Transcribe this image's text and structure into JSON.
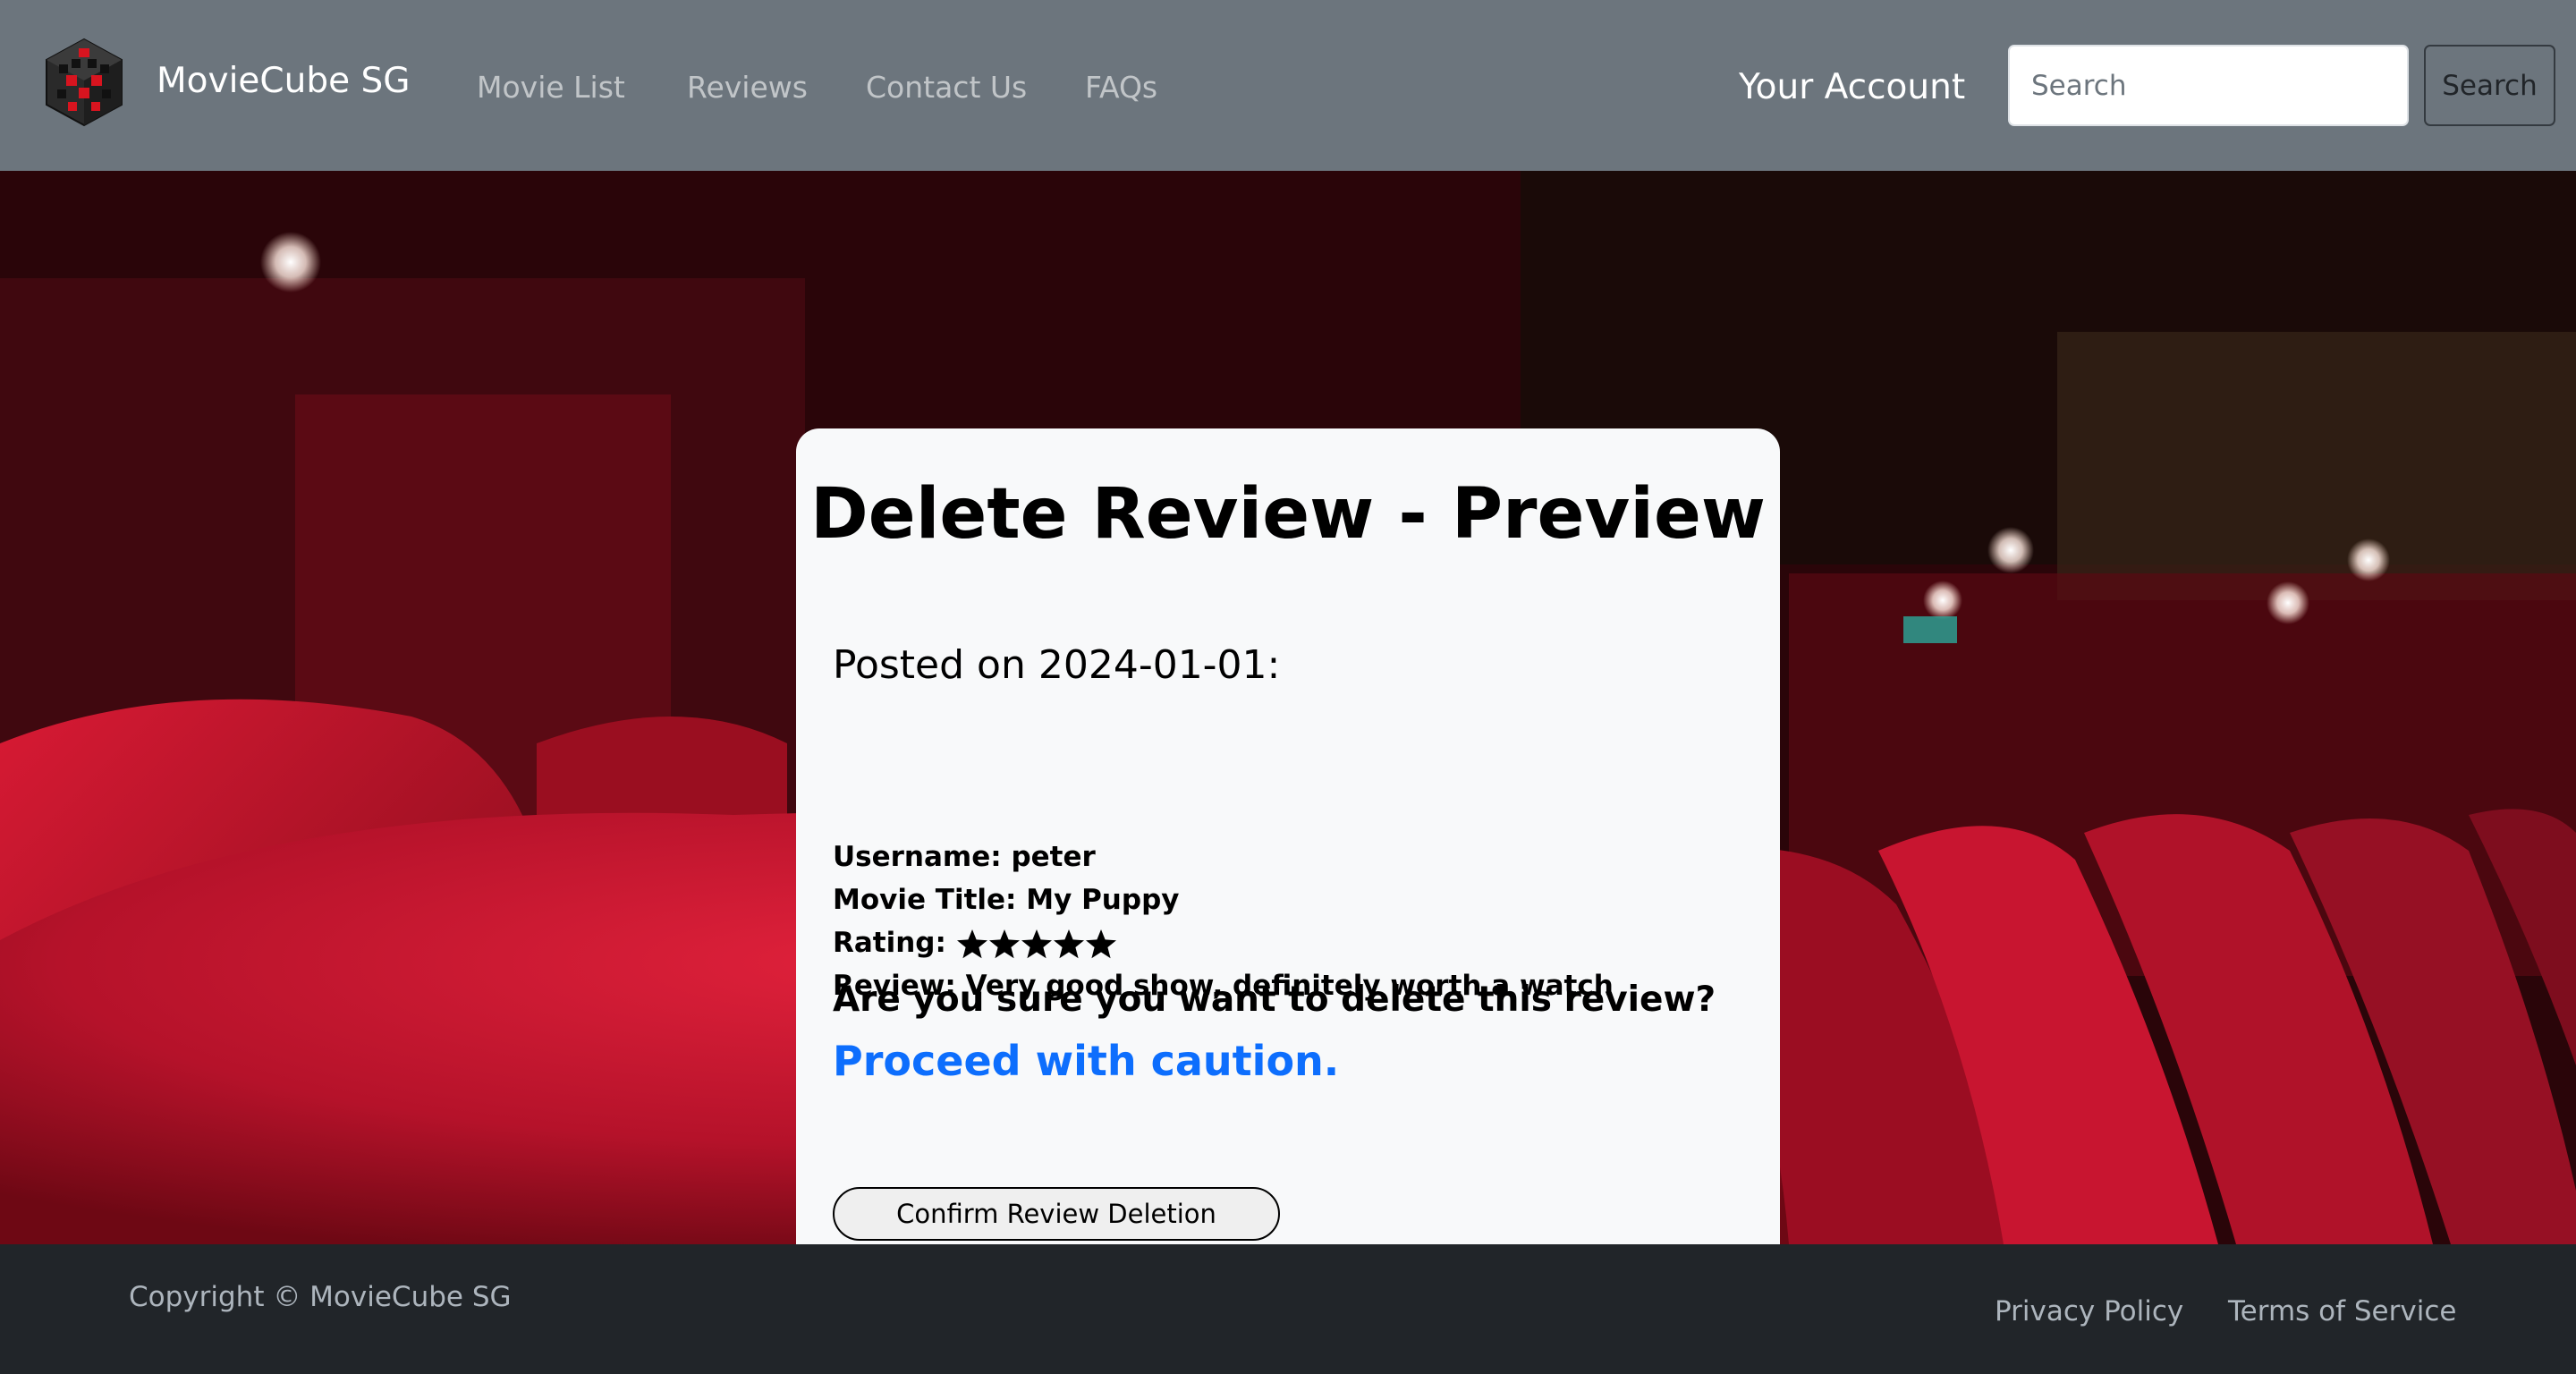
{
  "navbar": {
    "brand": "MovieCube SG",
    "links": [
      "Movie List",
      "Reviews",
      "Contact Us",
      "FAQs"
    ],
    "account": "Your Account",
    "search_placeholder": "Search",
    "search_button": "Search"
  },
  "card": {
    "title": "Delete Review - Preview",
    "posted": "Posted on 2024-01-01:",
    "username_label": "Username:",
    "username": "peter",
    "movie_label": "Movie Title:",
    "movie_title": "My Puppy",
    "rating_label": "Rating:",
    "rating": 5,
    "rating_max": 5,
    "review_label": "Review:",
    "review": "Very good show, definitely worth a watch",
    "confirm_question": "Are you sure you want to delete this review?",
    "caution": "Proceed with caution.",
    "confirm_button": "Confirm Review Deletion"
  },
  "footer": {
    "copyright": "Copyright © MovieCube SG",
    "links": [
      "Privacy Policy",
      "Terms of Service"
    ]
  },
  "colors": {
    "navbar_bg": "#6c757d",
    "footer_bg": "#212529",
    "card_bg": "#f8f9fa",
    "caution_text": "#0d6efd",
    "seat_red": "#c8102e"
  }
}
